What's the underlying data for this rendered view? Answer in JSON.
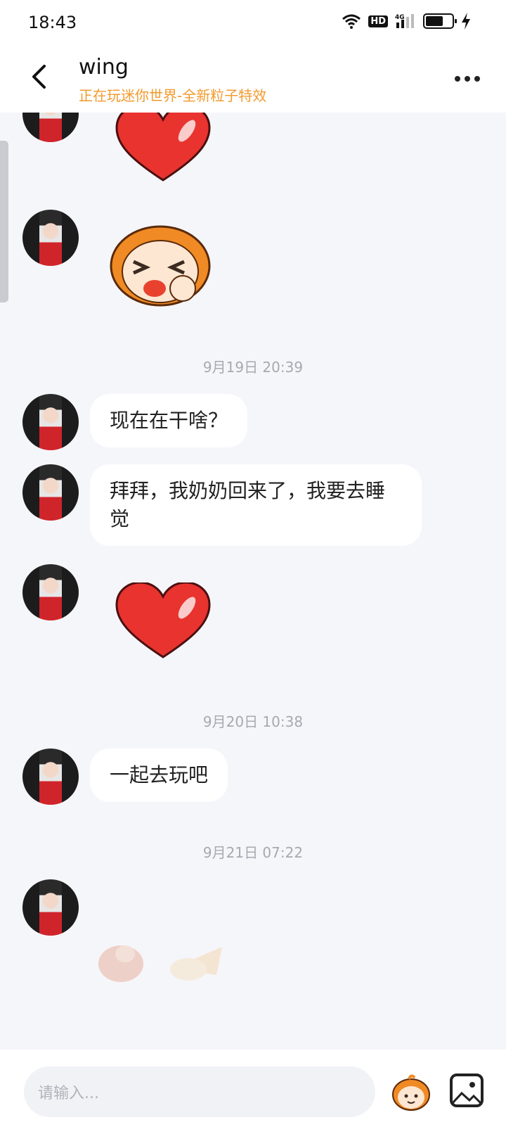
{
  "status_bar": {
    "time": "18:43",
    "network_badge": "HD",
    "network_type": "4G"
  },
  "header": {
    "contact_name": "wing",
    "contact_status": "正在玩迷你世界-全新粒子特效"
  },
  "messages": {
    "timestamp_1": "9月19日 20:39",
    "msg_1": "现在在干啥？",
    "msg_2": "拜拜，我奶奶回来了，我要去睡觉",
    "timestamp_2": "9月20日 10:38",
    "msg_3": "一起去玩吧",
    "timestamp_3": "9月21日 07:22"
  },
  "input": {
    "placeholder": "请输入..."
  },
  "colors": {
    "accent": "#f29a2e",
    "background": "#f5f6fa",
    "bubble": "#ffffff",
    "timestamp": "#a6a9b0"
  },
  "icons": [
    "back-icon",
    "more-icon",
    "wifi-icon",
    "signal-icon",
    "battery-icon",
    "charging-icon",
    "emoji-icon",
    "image-icon"
  ]
}
